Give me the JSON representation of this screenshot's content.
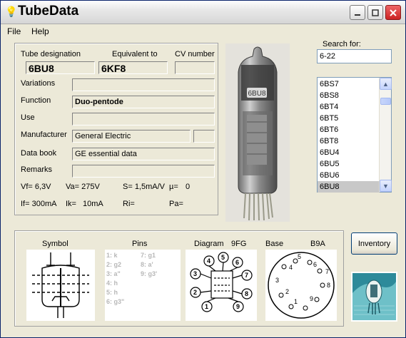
{
  "window": {
    "title": "TubeData"
  },
  "menu": [
    {
      "label": "File"
    },
    {
      "label": "Help"
    }
  ],
  "form": {
    "designation_label": "Tube designation",
    "designation_value": "6BU8",
    "equivalent_label": "Equivalent to",
    "equivalent_value": "6KF8",
    "cv_label": "CV number",
    "cv_value": "",
    "variations_label": "Variations",
    "function_label": "Function",
    "function_value": "Duo-pentode",
    "use_label": "Use",
    "manufacturer_label": "Manufacturer",
    "manufacturer_value": "General Electric",
    "databook_label": "Data book",
    "databook_value": "GE essential data",
    "remarks_label": "Remarks",
    "vf": "Vf= 6,3V",
    "va": "Va= 275V",
    "s": "S= 1,5mA/V",
    "mu": "µ=",
    "mu_value": "0",
    "if": "If= 300mA",
    "ik": "Ik=",
    "ik_value": "10mA",
    "ri": "Ri=",
    "pa": "Pa="
  },
  "search": {
    "label": "Search for:",
    "value": "6-22",
    "items": [
      "6BS7",
      "6BS8",
      "6BT4",
      "6BT5",
      "6BT6",
      "6BT8",
      "6BU4",
      "6BU5",
      "6BU6",
      "6BU8"
    ],
    "selected": "6BU8"
  },
  "bottom": {
    "symbol_label": "Symbol",
    "pins_label": "Pins",
    "diagram_label": "Diagram",
    "diagram_code": "9FG",
    "base_label": "Base",
    "base_code": "B9A",
    "pins_col1": [
      "1: k",
      "2: g2",
      "3: a\"",
      "4: h",
      "5: h",
      "6: g3\""
    ],
    "pins_col2": [
      "7: g1",
      "8: a'",
      "9: g3'"
    ],
    "inventory_label": "Inventory"
  },
  "colors": {
    "selection": "#c8c8c8",
    "close_button": "#d33"
  }
}
